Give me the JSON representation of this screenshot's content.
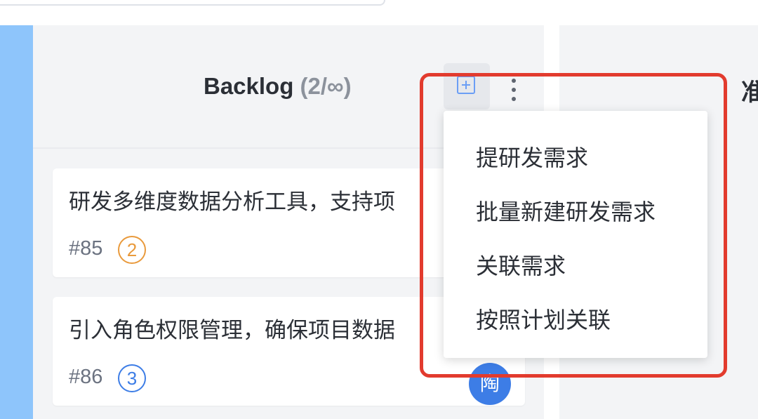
{
  "board": {
    "column": {
      "title": "Backlog",
      "count": "(2/∞)",
      "add_icon": "plus-square-icon",
      "more_icon": "more-vertical-icon"
    },
    "next_column": {
      "title_partial": "准"
    }
  },
  "cards": [
    {
      "title": "研发多维度数据分析工具，支持项",
      "id": "#85",
      "points": "2",
      "points_color": "#e99a3c"
    },
    {
      "title": "引入角色权限管理，确保项目数据",
      "id": "#86",
      "points": "3",
      "points_color": "#3d7de6",
      "assignee": "陶"
    }
  ],
  "menu": {
    "items": [
      {
        "label": "提研发需求"
      },
      {
        "label": "批量新建研发需求"
      },
      {
        "label": "关联需求"
      },
      {
        "label": "按照计划关联"
      }
    ]
  },
  "colors": {
    "highlight": "#e23b2e",
    "accent": "#3d7de6",
    "sidebar_strip": "#8ec5fb"
  }
}
